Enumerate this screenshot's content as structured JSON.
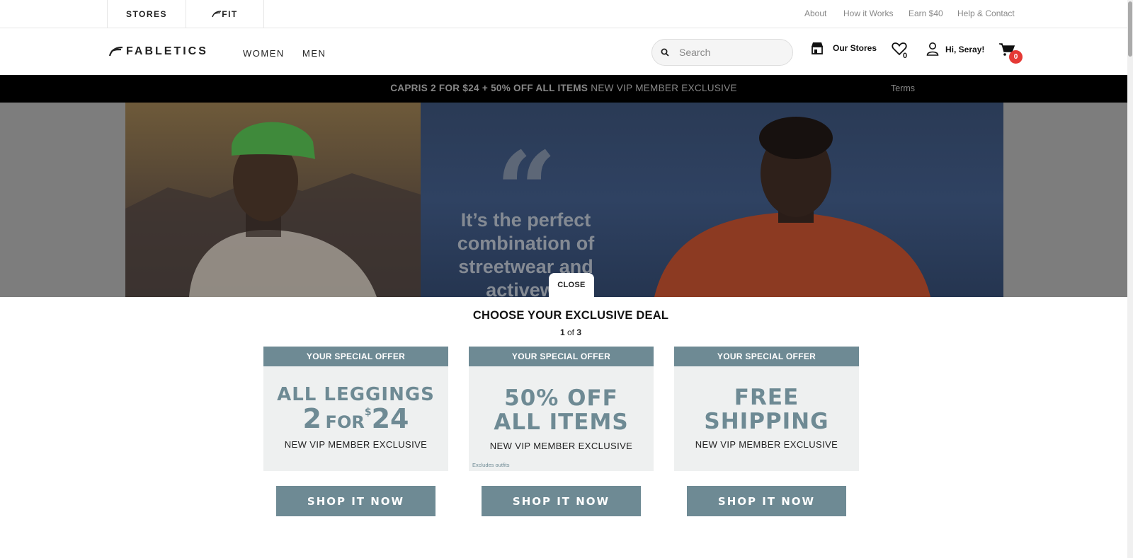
{
  "topbar": {
    "tabs": [
      {
        "label": "STORES"
      },
      {
        "label": "FIT"
      }
    ],
    "links": [
      "About",
      "How it Works",
      "Earn $40",
      "Help & Contact"
    ]
  },
  "nav": {
    "logo": "FABLETICS",
    "links": [
      "WOMEN",
      "MEN"
    ],
    "search_placeholder": "Search",
    "stores_label": "Our Stores",
    "wishlist_count": "0",
    "greeting": "Hi, Seray!",
    "cart_count": "0"
  },
  "promo": {
    "bold": "CAPRIS 2 FOR $24 + 50% OFF ALL ITEMS",
    "rest": "NEW VIP MEMBER EXCLUSIVE",
    "terms": "Terms"
  },
  "hero": {
    "quote": "It’s the perfect combination of streetwear and activewe"
  },
  "modal": {
    "close_label": "CLOSE",
    "title": "CHOOSE YOUR EXCLUSIVE DEAL",
    "pager_current": "1",
    "pager_of": "of",
    "pager_total": "3",
    "cards": [
      {
        "head": "YOUR SPECIAL OFFER",
        "line1": "ALL LEGGINGS",
        "line2a": "2",
        "line2b": "FOR",
        "line2c": "$",
        "line2d": "24",
        "sub": "NEW VIP MEMBER EXCLUSIVE",
        "button": "SHOP IT NOW"
      },
      {
        "head": "YOUR SPECIAL OFFER",
        "line1": "50% OFF",
        "line2": "ALL ITEMS",
        "sub": "NEW VIP MEMBER EXCLUSIVE",
        "note": "Excludes outfits",
        "button": "SHOP IT NOW"
      },
      {
        "head": "YOUR SPECIAL OFFER",
        "line1": "FREE",
        "line2": "SHIPPING",
        "sub": "NEW VIP MEMBER EXCLUSIVE",
        "button": "SHOP IT NOW"
      }
    ]
  },
  "colors": {
    "accent": "#6e8a94",
    "card_bg": "#eef0f0",
    "badge": "#e53935",
    "promo_bg": "#000000"
  }
}
